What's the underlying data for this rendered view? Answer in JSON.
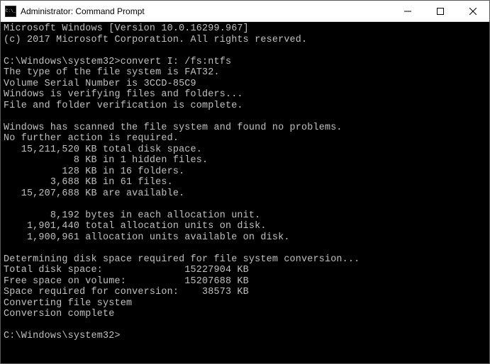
{
  "window": {
    "title": "Administrator: Command Prompt"
  },
  "terminal": {
    "lines": [
      "Microsoft Windows [Version 10.0.16299.967]",
      "(c) 2017 Microsoft Corporation. All rights reserved.",
      "",
      "C:\\Windows\\system32>convert I: /fs:ntfs",
      "The type of the file system is FAT32.",
      "Volume Serial Number is 3CCD-85C9",
      "Windows is verifying files and folders...",
      "File and folder verification is complete.",
      "",
      "Windows has scanned the file system and found no problems.",
      "No further action is required.",
      "   15,211,520 KB total disk space.",
      "            8 KB in 1 hidden files.",
      "          128 KB in 16 folders.",
      "        3,688 KB in 61 files.",
      "   15,207,688 KB are available.",
      "",
      "        8,192 bytes in each allocation unit.",
      "    1,901,440 total allocation units on disk.",
      "    1,900,961 allocation units available on disk.",
      "",
      "Determining disk space required for file system conversion...",
      "Total disk space:              15227904 KB",
      "Free space on volume:          15207688 KB",
      "Space required for conversion:    38573 KB",
      "Converting file system",
      "Conversion complete",
      "",
      "C:\\Windows\\system32>"
    ]
  }
}
